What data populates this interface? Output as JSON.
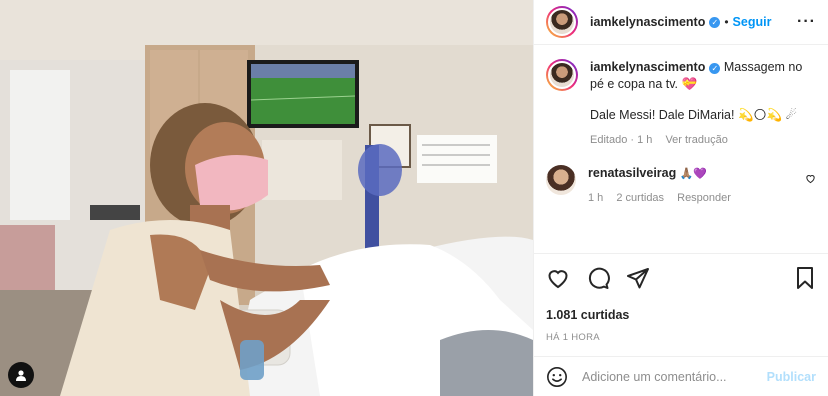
{
  "header": {
    "username": "iamkelynascimento",
    "separator": "•",
    "follow_label": "Seguir",
    "more_label": "···"
  },
  "caption": {
    "username": "iamkelynascimento",
    "line1": "Massagem no pé e copa na tv. 💝",
    "line2": "Dale Messi! Dale DiMaria! 💫🌕💫 ☄",
    "edited": "Editado · 1 h",
    "translate": "Ver tradução"
  },
  "comment": {
    "username": "renatasilveirag",
    "text": "🙏🏽💜",
    "time": "1 h",
    "likes": "2 curtidas",
    "reply": "Responder"
  },
  "post": {
    "likes": "1.081 curtidas",
    "time": "HÁ 1 HORA"
  },
  "add_comment": {
    "placeholder": "Adicione um comentário...",
    "post_label": "Publicar"
  },
  "icons": {
    "like": "heart-icon",
    "comment": "comment-icon",
    "share": "share-icon",
    "save": "bookmark-icon",
    "emoji": "emoji-icon",
    "tags": "user-tag-icon",
    "verified": "verified-badge-icon"
  },
  "colors": {
    "accent": "#0095f6",
    "verified": "#3897f0",
    "muted": "#8e8e8e",
    "post_disabled": "#b2dffc"
  }
}
